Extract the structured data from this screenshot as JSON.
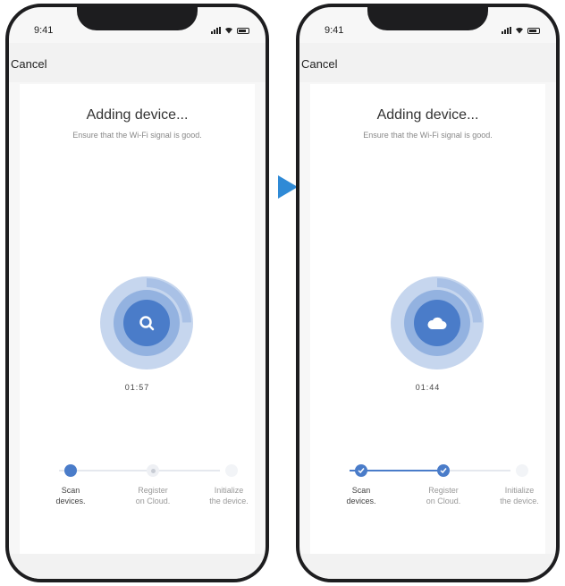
{
  "colors": {
    "accent": "#4a7cc9",
    "ring_outer": "#c6d6ee",
    "ring_mid": "#93b2e0",
    "arrow": "#2f8ad6"
  },
  "arrow_icon": "play-triangle-icon",
  "screens": [
    {
      "status_time": "9:41",
      "cancel_label": "Cancel",
      "title": "Adding device...",
      "subtitle": "Ensure that the Wi-Fi signal is good.",
      "center_icon": "search-icon",
      "timer": "01:57",
      "progress_fraction": 0.25,
      "steps": [
        {
          "line1": "Scan",
          "line2": "devices.",
          "state": "active"
        },
        {
          "line1": "Register",
          "line2": "on Cloud.",
          "state": "pending"
        },
        {
          "line1": "Initialize",
          "line2": "the device.",
          "state": "pending"
        }
      ]
    },
    {
      "status_time": "9:41",
      "cancel_label": "Cancel",
      "title": "Adding device...",
      "subtitle": "Ensure that the Wi-Fi signal is good.",
      "center_icon": "cloud-icon",
      "timer": "01:44",
      "progress_fraction": 0.25,
      "steps": [
        {
          "line1": "Scan",
          "line2": "devices.",
          "state": "done"
        },
        {
          "line1": "Register",
          "line2": "on Cloud.",
          "state": "done"
        },
        {
          "line1": "Initialize",
          "line2": "the device.",
          "state": "pending"
        }
      ]
    }
  ]
}
